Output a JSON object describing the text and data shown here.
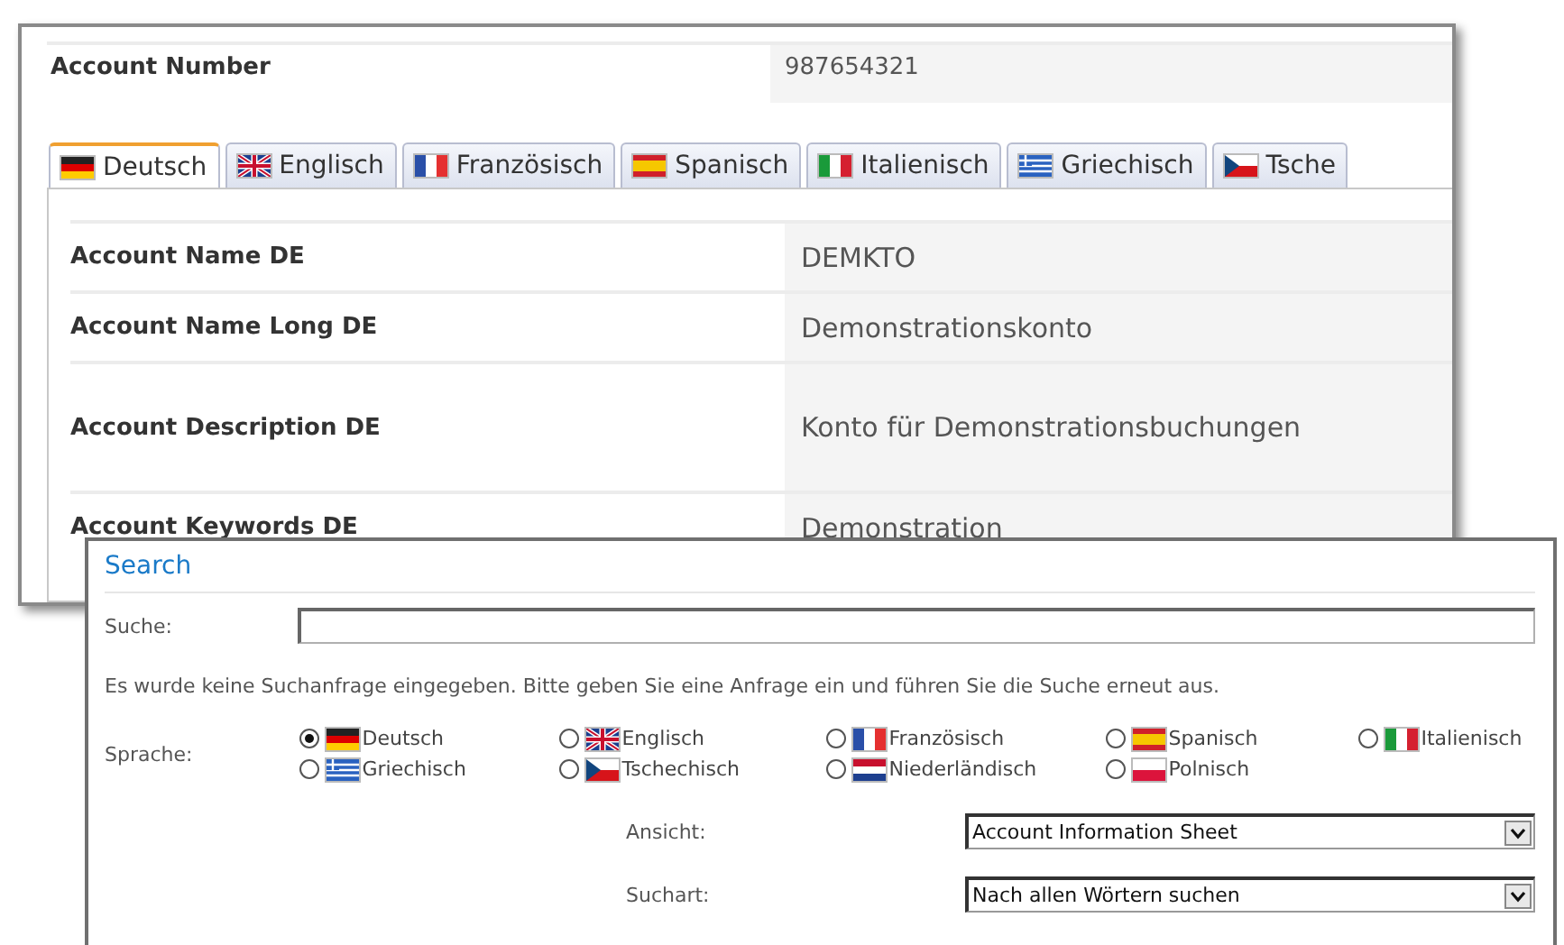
{
  "account_panel": {
    "account_number": {
      "label": "Account Number",
      "value": "987654321"
    },
    "tabs": [
      {
        "label": "Deutsch",
        "kind": "de",
        "selected": true
      },
      {
        "label": "Englisch",
        "kind": "gb",
        "selected": false
      },
      {
        "label": "Französisch",
        "kind": "fr",
        "selected": false
      },
      {
        "label": "Spanisch",
        "kind": "es",
        "selected": false
      },
      {
        "label": "Italienisch",
        "kind": "it",
        "selected": false
      },
      {
        "label": "Griechisch",
        "kind": "gr",
        "selected": false
      },
      {
        "label": "Tsche",
        "kind": "cz",
        "selected": false
      }
    ],
    "fields": [
      {
        "label": "Account Name DE",
        "value": "DEMKTO",
        "kind": "short"
      },
      {
        "label": "Account Name Long DE",
        "value": "Demonstrationskonto",
        "kind": "short"
      },
      {
        "label": "Account Description DE",
        "value": "Konto für Demonstrationsbuchungen",
        "kind": "tall"
      },
      {
        "label": "Account Keywords DE",
        "value": "Demonstration",
        "kind": "short"
      }
    ]
  },
  "search_panel": {
    "title": "Search",
    "search": {
      "label": "Suche:"
    },
    "message": "Es wurde keine Suchanfrage eingegeben. Bitte geben Sie eine Anfrage ein und führen Sie die Suche erneut aus.",
    "language": {
      "label": "Sprache:",
      "options": [
        {
          "label": "Deutsch",
          "kind": "de",
          "selected": true
        },
        {
          "label": "Englisch",
          "kind": "gb",
          "selected": false
        },
        {
          "label": "Französisch",
          "kind": "fr",
          "selected": false
        },
        {
          "label": "Spanisch",
          "kind": "es",
          "selected": false
        },
        {
          "label": "Italienisch",
          "kind": "it",
          "selected": false
        },
        {
          "label": "Griechisch",
          "kind": "gr",
          "selected": false
        },
        {
          "label": "Tschechisch",
          "kind": "cz",
          "selected": false
        },
        {
          "label": "Niederländisch",
          "kind": "nl",
          "selected": false
        },
        {
          "label": "Polnisch",
          "kind": "pl",
          "selected": false
        }
      ]
    },
    "selects": [
      {
        "label": "Ansicht:",
        "value": "Account Information Sheet"
      },
      {
        "label": "Suchart:",
        "value": "Nach allen Wörtern suchen"
      }
    ]
  }
}
